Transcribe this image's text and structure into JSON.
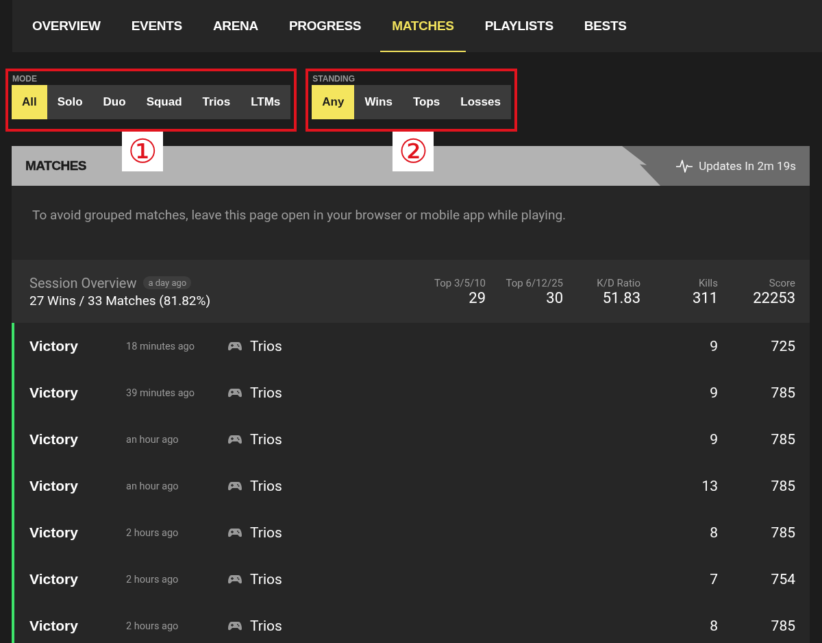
{
  "nav": {
    "tabs": [
      {
        "label": "OVERVIEW",
        "selected": false
      },
      {
        "label": "EVENTS",
        "selected": false
      },
      {
        "label": "ARENA",
        "selected": false
      },
      {
        "label": "PROGRESS",
        "selected": false
      },
      {
        "label": "MATCHES",
        "selected": true
      },
      {
        "label": "PLAYLISTS",
        "selected": false
      },
      {
        "label": "BESTS",
        "selected": false
      }
    ]
  },
  "filters": [
    {
      "label": "MODE",
      "annotation": "①",
      "options": [
        {
          "label": "All",
          "selected": true
        },
        {
          "label": "Solo",
          "selected": false
        },
        {
          "label": "Duo",
          "selected": false
        },
        {
          "label": "Squad",
          "selected": false
        },
        {
          "label": "Trios",
          "selected": false
        },
        {
          "label": "LTMs",
          "selected": false
        }
      ]
    },
    {
      "label": "STANDING",
      "annotation": "②",
      "options": [
        {
          "label": "Any",
          "selected": true
        },
        {
          "label": "Wins",
          "selected": false
        },
        {
          "label": "Tops",
          "selected": false
        },
        {
          "label": "Losses",
          "selected": false
        }
      ]
    }
  ],
  "matches_panel": {
    "title": "MATCHES",
    "update_status": "Updates In 2m 19s",
    "notice": "To avoid grouped matches, leave this page open in your browser or mobile app while playing.",
    "session": {
      "title": "Session Overview",
      "age": "a day ago",
      "summary": "27 Wins / 33 Matches (81.82%)",
      "stats": [
        {
          "label": "Top 3/5/10",
          "value": "29"
        },
        {
          "label": "Top 6/12/25",
          "value": "30"
        },
        {
          "label": "K/D Ratio",
          "value": "51.83"
        },
        {
          "label": "Kills",
          "value": "311"
        },
        {
          "label": "Score",
          "value": "22253"
        }
      ]
    },
    "rows": [
      {
        "result": "Victory",
        "won": true,
        "time": "18 minutes ago",
        "mode": "Trios",
        "kills": "9",
        "score": "725"
      },
      {
        "result": "Victory",
        "won": true,
        "time": "39 minutes ago",
        "mode": "Trios",
        "kills": "9",
        "score": "785"
      },
      {
        "result": "Victory",
        "won": true,
        "time": "an hour ago",
        "mode": "Trios",
        "kills": "9",
        "score": "785"
      },
      {
        "result": "Victory",
        "won": true,
        "time": "an hour ago",
        "mode": "Trios",
        "kills": "13",
        "score": "785"
      },
      {
        "result": "Victory",
        "won": true,
        "time": "2 hours ago",
        "mode": "Trios",
        "kills": "8",
        "score": "785"
      },
      {
        "result": "Victory",
        "won": true,
        "time": "2 hours ago",
        "mode": "Trios",
        "kills": "7",
        "score": "754"
      },
      {
        "result": "Victory",
        "won": true,
        "time": "2 hours ago",
        "mode": "Trios",
        "kills": "8",
        "score": "785"
      }
    ]
  }
}
